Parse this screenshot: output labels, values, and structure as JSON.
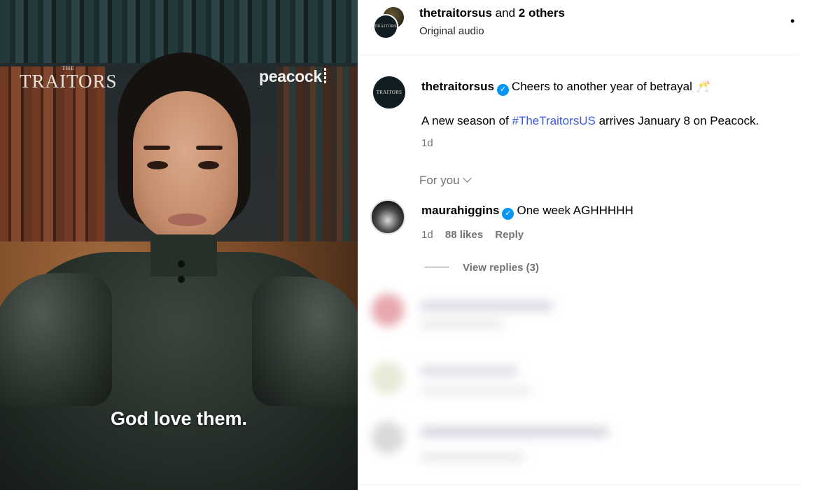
{
  "media": {
    "logo_the": "THE",
    "logo_main": "TRAITORS",
    "network_logo": "peacock",
    "caption": "God love them."
  },
  "header": {
    "username": "thetraitorsus",
    "collab_suffix": "and",
    "collab_others": "2 others",
    "audio": "Original audio",
    "more_icon": "more-dots-icon"
  },
  "post": {
    "username": "thetraitorsus",
    "verified_icon": "verified-badge-icon",
    "caption_text": "Cheers to another year of betrayal 🥂",
    "line2_prefix": "A new season of ",
    "hashtag": "#TheTraitorsUS",
    "line2_suffix": " arrives January 8 on Peacock.",
    "time": "1d"
  },
  "sort": {
    "label": "For you"
  },
  "comments": [
    {
      "username": "maurahiggins",
      "text": "One week AGHHHHH",
      "time": "1d",
      "likes": "88 likes",
      "reply": "Reply",
      "view_replies": "View replies (3)"
    }
  ],
  "avatar_logo_text": "TRAITORS",
  "colors": {
    "verified": "#0095f6",
    "hashtag": "#3b5bdb",
    "secondary_text": "#737373",
    "divider": "#efefef"
  }
}
